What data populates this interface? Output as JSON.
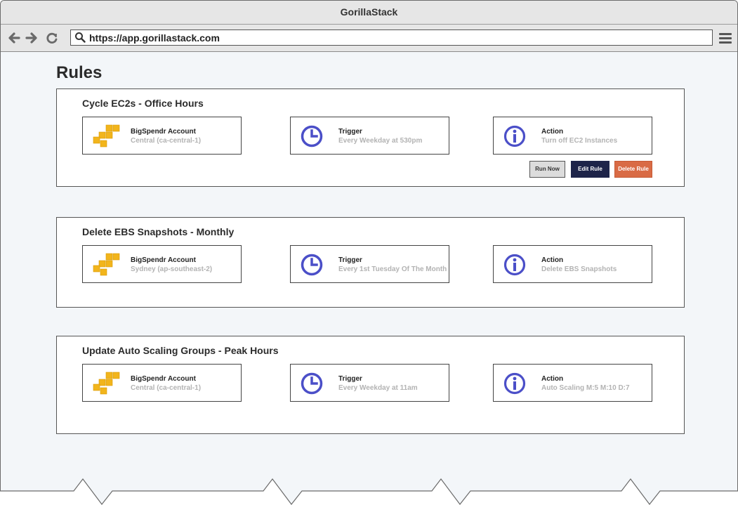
{
  "window": {
    "title": "GorillaStack"
  },
  "toolbar": {
    "url": "https://app.gorillastack.com"
  },
  "page": {
    "title": "Rules"
  },
  "rules": [
    {
      "title": "Cycle EC2s - Office Hours",
      "account": {
        "label": "BigSpendr Account",
        "value": "Central (ca-central-1)"
      },
      "trigger": {
        "label": "Trigger",
        "value": "Every Weekday at 530pm"
      },
      "action": {
        "label": "Action",
        "value": "Turn off EC2 Instances"
      },
      "buttons": {
        "run": "Run Now",
        "edit": "Edit Rule",
        "delete": "Delete Rule"
      }
    },
    {
      "title": "Delete EBS Snapshots - Monthly",
      "account": {
        "label": "BigSpendr Account",
        "value": "Sydney (ap-southeast-2)"
      },
      "trigger": {
        "label": "Trigger",
        "value": "Every 1st Tuesday Of The Month"
      },
      "action": {
        "label": "Action",
        "value": "Delete EBS Snapshots"
      }
    },
    {
      "title": "Update Auto Scaling Groups - Peak Hours",
      "account": {
        "label": "BigSpendr Account",
        "value": "Central (ca-central-1)"
      },
      "trigger": {
        "label": "Trigger",
        "value": "Every Weekday at 11am"
      },
      "action": {
        "label": "Action",
        "value": "Auto Scaling M:5 M:10 D:7"
      }
    }
  ],
  "colors": {
    "aws_icon": "#f2b51c",
    "info_icon": "#4b4fc8",
    "edit_button": "#1e2449",
    "delete_button": "#d96b45",
    "page_background": "#f3f6f9"
  },
  "icons": {
    "account": "aws-cubes-icon",
    "trigger": "clock-icon",
    "action": "info-icon"
  }
}
